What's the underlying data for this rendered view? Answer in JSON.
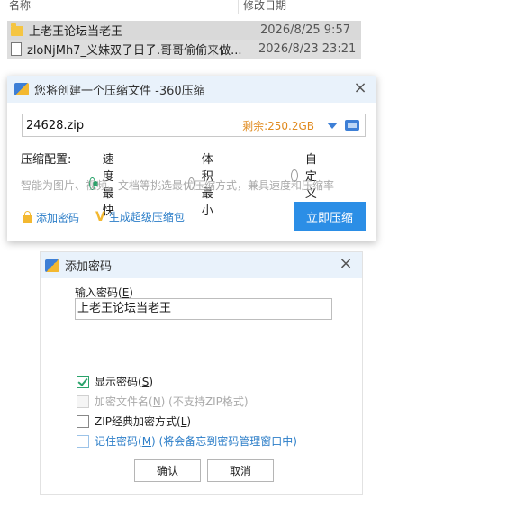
{
  "explorer": {
    "col_name": "名称",
    "col_date": "修改日期",
    "files": [
      {
        "name": "上老王论坛当老王",
        "date": "2026/8/25 9:57",
        "type": "folder"
      },
      {
        "name": "zloNjMh7_义妹双子日子.哥哥偷偷来做...",
        "date": "2026/8/23 23:21",
        "type": "file"
      }
    ]
  },
  "zip_dialog": {
    "title": "您将创建一个压缩文件 -360压缩",
    "path": "24628.zip",
    "free_space": "剩余:250.2GB",
    "config_label": "压缩配置:",
    "options": [
      "速度最快",
      "体积最小",
      "自定义"
    ],
    "selected": "速度最快",
    "hint": "智能为图片、视频、文档等挑选最优压缩方式，兼具速度和压缩率",
    "add_password": "添加密码",
    "super_pack": "生成超级压缩包",
    "compress_now": "立即压缩",
    "colors": {
      "accent": "#2b8ee6",
      "free": "#e08a1e",
      "radio": "#2aa36b"
    }
  },
  "pw_dialog": {
    "title": "添加密码",
    "input_label": "输入密码(",
    "input_key": "E",
    "input_label_end": ")",
    "password": "上老王论坛当老王",
    "show_pw": {
      "text": "显示密码(",
      "key": "S",
      "end": ")",
      "checked": true
    },
    "encrypt_names": {
      "text": "加密文件名(",
      "key": "N",
      "end": ") (不支持ZIP格式)",
      "disabled": true
    },
    "zip_classic": {
      "text": "ZIP经典加密方式(",
      "key": "L",
      "end": ")",
      "checked": false
    },
    "remember": {
      "text": "记住密码(",
      "key": "M",
      "end": ") (将会备忘到密码管理窗口中)",
      "checked": false
    },
    "ok": "确认",
    "cancel": "取消"
  }
}
